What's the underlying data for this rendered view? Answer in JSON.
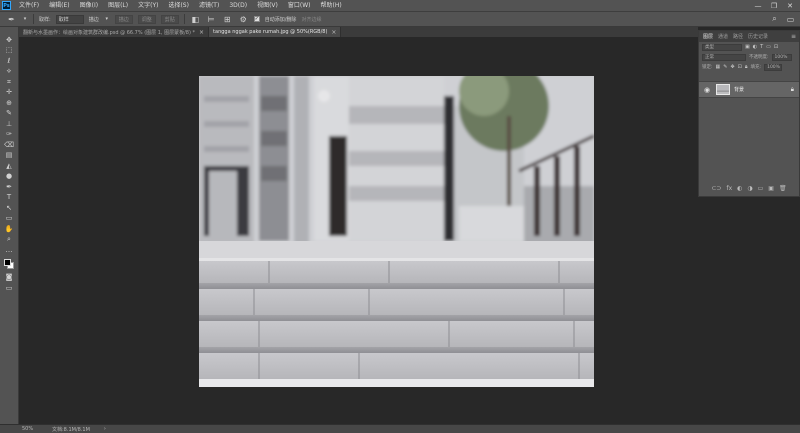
{
  "menubar": {
    "logo": "Ps",
    "items": [
      "文件(F)",
      "编辑(E)",
      "图像(I)",
      "图层(L)",
      "文字(Y)",
      "选择(S)",
      "滤镜(T)",
      "3D(D)",
      "视图(V)",
      "窗口(W)",
      "帮助(H)"
    ],
    "controls": [
      "—",
      "❐",
      "✕"
    ]
  },
  "options": {
    "sample_label": "取样:",
    "sample_value": "取样",
    "mode_value": "描边",
    "buttons": [
      "描边",
      "调整",
      "剪贴"
    ],
    "auto_add_label": "自动添加/删除",
    "align_edges": "对齐边缘"
  },
  "tabs": [
    {
      "label": "翻新与水墨画作：绘画对象建筑群改编.psd @ 66.7% (图层 1, 图层蒙板/8) *",
      "active": false
    },
    {
      "label": "tangga nggak pake rumah.jpg @ 50%(RGB/8)",
      "active": true
    }
  ],
  "tools": [
    "✥",
    "⬚",
    "ℓ",
    "⟡",
    "⌗",
    "✛",
    "⊕",
    "✎",
    "⊥",
    "✑",
    "⌫",
    "▤",
    "◭",
    "●",
    "✒",
    "T",
    "↖",
    "▭",
    "✋",
    "⌕",
    "…"
  ],
  "status": {
    "zoom": "50%",
    "doc": "文档:8.1M/8.1M",
    "arrow": "›"
  },
  "layers_panel": {
    "tabs": [
      "图层",
      "通道",
      "路径",
      "历史记录"
    ],
    "menu_icon": "≡",
    "filter_label": "类型",
    "blend_mode": "正常",
    "opacity_label": "不透明度:",
    "opacity_value": "100%",
    "lock_label": "锁定:",
    "fill_label": "填充:",
    "fill_value": "100%",
    "layer_name": "背景",
    "footer_icons": [
      "⊂⊃",
      "fx",
      "◐",
      "◑",
      "▭",
      "▣",
      "🗑"
    ]
  },
  "colors": {
    "menubar": "#535353",
    "workspace": "#282828",
    "canvas_bg": "#c9c9cb"
  }
}
